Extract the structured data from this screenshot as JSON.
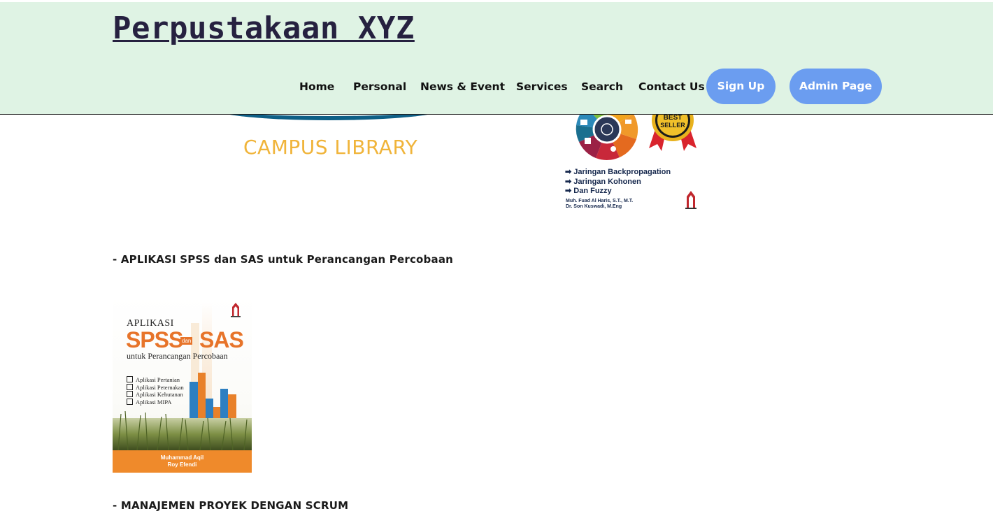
{
  "header": {
    "site_title": "Perpustakaan XYZ",
    "nav": {
      "home": "Home",
      "personal": "Personal",
      "news_event": "News & Event",
      "services": "Services",
      "search": "Search",
      "contact_us": "Contact Us",
      "sign_up": "Sign Up",
      "admin_page": "Admin Page"
    },
    "colors": {
      "header_bg": "#dff3e4",
      "button_bg": "#6b9df0",
      "title_color": "#262140"
    }
  },
  "campus_logo": {
    "text": "CAMPUS LIBRARY"
  },
  "neural_book_cover": {
    "badge": [
      "BEST",
      "SELLER"
    ],
    "list": [
      "Jaringan Backpropagation",
      "Jaringan Kohonen",
      "Dan Fuzzy"
    ],
    "authors": [
      "Muh. Fuad Al Haris, S.T., M.T.",
      "Dr. Son Kuswadi, M.Eng"
    ]
  },
  "books": [
    {
      "title": "- APLIKASI SPSS dan SAS untuk Perancangan Percobaan",
      "cover": {
        "heading": "APLIKASI",
        "brand_left": "SPSS",
        "joiner": "dan",
        "brand_right": "SAS",
        "subtitle": "untuk Perancangan Percobaan",
        "checklist": [
          "Aplikasi Pertanian",
          "Aplikasi Peternakan",
          "Aplikasi Kehutanan",
          "Aplikasi MIPA"
        ],
        "authors": [
          "Muhammad Aqil",
          "Roy Efendi"
        ]
      }
    },
    {
      "title": "- MANAJEMEN PROYEK DENGAN SCRUM"
    }
  ]
}
